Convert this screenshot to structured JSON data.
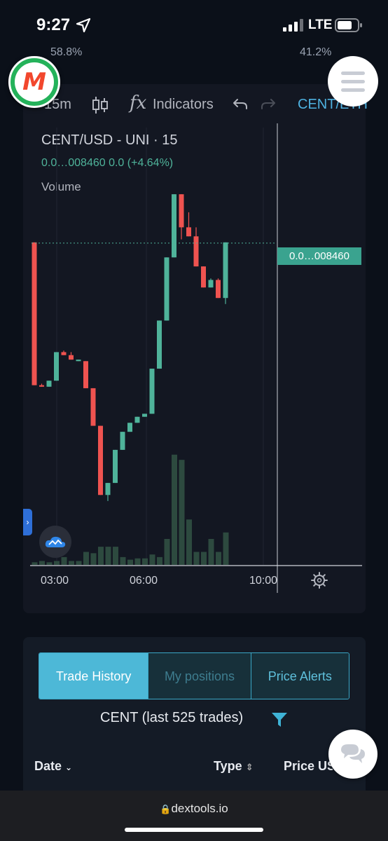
{
  "status_bar": {
    "time": "9:27",
    "network": "LTE"
  },
  "header": {
    "left_percent": "58.8%",
    "right_percent": "41.2%",
    "logo_letter": "M"
  },
  "toolbar": {
    "interval": "15m",
    "indicators_label": "Indicators",
    "pair": "CENT/ETH",
    "fx_symbol": "fx"
  },
  "chart": {
    "symbol_title": "CENT/USD - UNI · 15",
    "ohlc_text": "0.0…008460 0.0 (+4.64%)",
    "volume_label": "Volume",
    "last_price_tag": "0.0…008460",
    "colors": {
      "up": "#4fb39a",
      "down": "#ef5350",
      "volume": "#2d4a3f",
      "bg": "#131722"
    },
    "x_ticks": [
      "03:00",
      "06:00",
      "10:00"
    ]
  },
  "chart_data": {
    "type": "candlestick",
    "title": "CENT/USD - UNI · 15",
    "x_tick_labels": [
      "03:00",
      "06:00",
      "10:00"
    ],
    "candles": [
      {
        "o": 100,
        "h": 100,
        "c": 5,
        "l": 5,
        "dir": "down"
      },
      {
        "o": 5,
        "h": 6,
        "c": 4,
        "l": 4,
        "dir": "down"
      },
      {
        "o": 4,
        "h": 8,
        "c": 8,
        "l": 4,
        "dir": "up"
      },
      {
        "o": 8,
        "h": 27,
        "c": 27,
        "l": 8,
        "dir": "up"
      },
      {
        "o": 27,
        "h": 28,
        "c": 25,
        "l": 25,
        "dir": "down"
      },
      {
        "o": 25,
        "h": 27,
        "c": 22,
        "l": 22,
        "dir": "down"
      },
      {
        "o": 22,
        "h": 22,
        "c": 21,
        "l": 21,
        "dir": "up"
      },
      {
        "o": 21,
        "h": 21,
        "c": 3,
        "l": 3,
        "dir": "down"
      },
      {
        "o": 3,
        "h": 3,
        "c": -22,
        "l": -22,
        "dir": "down"
      },
      {
        "o": -22,
        "h": -22,
        "c": -68,
        "l": -68,
        "dir": "down"
      },
      {
        "o": -68,
        "h": -60,
        "c": -60,
        "l": -72,
        "dir": "up"
      },
      {
        "o": -60,
        "h": -38,
        "c": -38,
        "l": -60,
        "dir": "up"
      },
      {
        "o": -38,
        "h": -26,
        "c": -26,
        "l": -38,
        "dir": "up"
      },
      {
        "o": -26,
        "h": -20,
        "c": -20,
        "l": -26,
        "dir": "up"
      },
      {
        "o": -20,
        "h": -16,
        "c": -16,
        "l": -20,
        "dir": "up"
      },
      {
        "o": -16,
        "h": -14,
        "c": -14,
        "l": -16,
        "dir": "up"
      },
      {
        "o": -14,
        "h": 16,
        "c": 16,
        "l": -14,
        "dir": "up"
      },
      {
        "o": 16,
        "h": 48,
        "c": 48,
        "l": 16,
        "dir": "up"
      },
      {
        "o": 48,
        "h": 90,
        "c": 90,
        "l": 48,
        "dir": "up"
      },
      {
        "o": 90,
        "h": 132,
        "c": 132,
        "l": 90,
        "dir": "up"
      },
      {
        "o": 132,
        "h": 132,
        "c": 110,
        "l": 102,
        "dir": "down"
      },
      {
        "o": 110,
        "h": 120,
        "c": 104,
        "l": 104,
        "dir": "down"
      },
      {
        "o": 104,
        "h": 110,
        "c": 84,
        "l": 84,
        "dir": "down"
      },
      {
        "o": 84,
        "h": 84,
        "c": 70,
        "l": 70,
        "dir": "down"
      },
      {
        "o": 70,
        "h": 76,
        "c": 75,
        "l": 70,
        "dir": "up"
      },
      {
        "o": 75,
        "h": 76,
        "c": 63,
        "l": 63,
        "dir": "down"
      },
      {
        "o": 63,
        "h": 100,
        "c": 100,
        "l": 59,
        "dir": "up"
      }
    ],
    "volume": [
      2,
      3,
      2,
      3,
      6,
      3,
      3,
      10,
      9,
      14,
      14,
      14,
      6,
      4,
      5,
      5,
      8,
      6,
      20,
      85,
      81,
      35,
      10,
      10,
      20,
      10,
      25
    ],
    "last_price": "0.0…008460"
  },
  "trade": {
    "tabs": [
      "Trade History",
      "My positions",
      "Price Alerts"
    ],
    "title": "CENT (last 525 trades)",
    "columns": [
      "Date",
      "Type",
      "Price USD"
    ]
  },
  "browser": {
    "url": "dextools.io"
  }
}
